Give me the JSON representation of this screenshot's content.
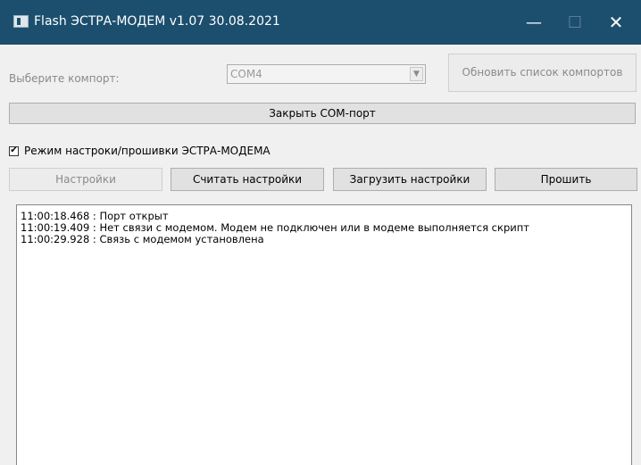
{
  "window": {
    "title": "Flash ЭСТРА-МОДЕМ v1.07 30.08.2021",
    "minimize_glyph": "—",
    "maximize_glyph": "☐",
    "close_glyph": "✕"
  },
  "port": {
    "label": "Выберите компорт:",
    "selected": "COM4",
    "dropdown_glyph": "▼",
    "refresh_label": "Обновить список компортов",
    "close_port_label": "Закрыть COM-порт"
  },
  "mode": {
    "checked": true,
    "check_glyph": "✔",
    "label": "Режим настроки/прошивки ЭСТРА-МОДЕМА"
  },
  "actions": {
    "settings": "Настройки",
    "read": "Считать настройки",
    "load": "Загрузить настройки",
    "flash": "Прошить"
  },
  "log": [
    "11:00:18.468 : Порт открыт",
    "11:00:19.409 : Нет связи с модемом. Модем не подключен или в модеме выполняется скрипт",
    "11:00:29.928 : Связь с модемом установлена"
  ],
  "colors": {
    "titlebar": "#1c4f6e",
    "window_bg": "#f0f0f0",
    "button_bg": "#e1e1e1"
  }
}
